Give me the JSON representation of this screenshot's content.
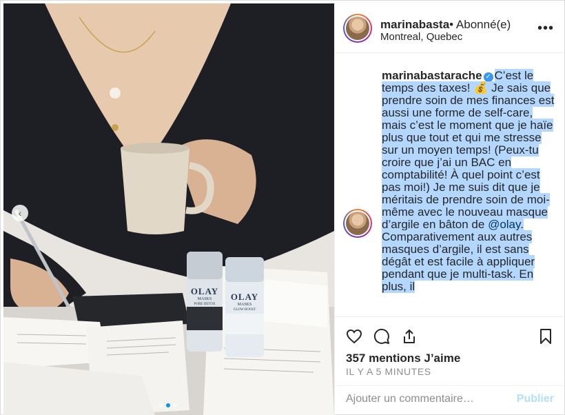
{
  "post": {
    "username": "marinabasta",
    "follow_state": "• Abonné(e)",
    "location": "Montreal, Quebec",
    "more_icon": "ellipsis-icon"
  },
  "photo": {
    "product_1_brand": "OLAY",
    "product_1_line": "MASKS",
    "product_1_name": "PORE DETOX",
    "product_2_brand": "OLAY",
    "product_2_line": "MASKS",
    "product_2_name": "GLOW BOOST",
    "carousel_arrow_icon": "chevron-left-icon"
  },
  "caption": {
    "author": "marinabastarache",
    "verified_icon": "verified-badge-icon",
    "text_part1": "C’est le temps des taxes! 💰 Je sais que prendre soin de mes finances est aussi une forme de self-care, mais c’est le moment que je haïe plus que tout et qui me stresse sur un moyen temps! (Peux-tu croire que j’ai un BAC en comptabilité! À quel point c’est pas moi!) Je me suis dit que je méritais de prendre soin de moi-même avec le nouveau masque d’argile en bâton de ",
    "mention": "@olay",
    "text_part2": ". Comparativement aux autres masques d’argile, il est sans dégât et est facile à appliquer pendant que je multi-task. En plus, il"
  },
  "actions": {
    "like_icon": "heart-icon",
    "comment_icon": "comment-icon",
    "share_icon": "share-icon",
    "save_icon": "bookmark-icon",
    "likes_text": "357 mentions J’aime",
    "timestamp": "IL Y A 5 MINUTES"
  },
  "comment": {
    "placeholder": "Ajouter un commentaire…",
    "publish_label": "Publier"
  },
  "colors": {
    "selection": "#b3d7ff",
    "publish_disabled": "#b2dffc",
    "verified": "#3897f0"
  }
}
